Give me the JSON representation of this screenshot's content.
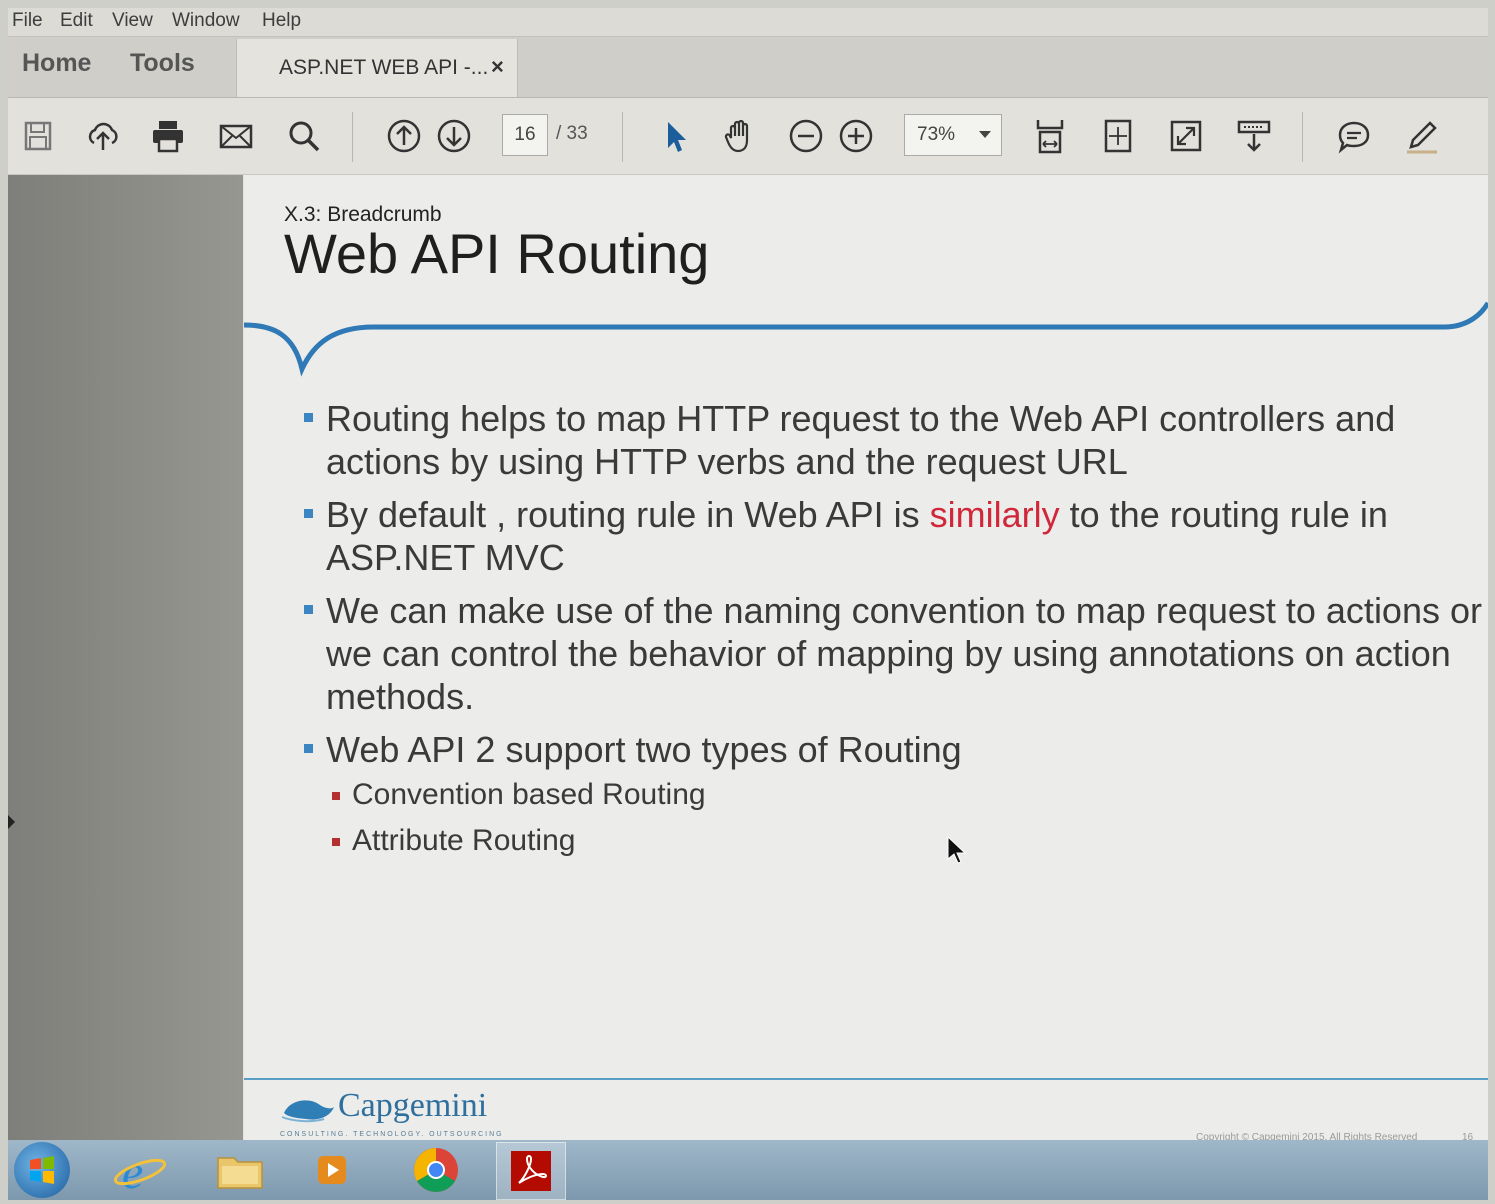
{
  "menu": [
    "File",
    "Edit",
    "View",
    "Window",
    "Help"
  ],
  "tabs": {
    "home": "Home",
    "tools": "Tools",
    "document": "ASP.NET WEB API -...",
    "close": "×"
  },
  "toolbar": {
    "current_page": "16",
    "total_pages": "/ 33",
    "zoom": "73%"
  },
  "slide": {
    "breadcrumb": "X.3: Breadcrumb",
    "title": "Web API Routing",
    "bullets": [
      {
        "text": "Routing helps to map HTTP request to the Web API controllers and actions by using HTTP verbs and the request URL"
      },
      {
        "before": "By default , routing rule in Web API is ",
        "highlight": "similarly",
        "after": " to the routing rule in ASP.NET MVC"
      },
      {
        "text": "We can make use of the naming convention to map request to actions or we can control the behavior of mapping by using annotations on action methods."
      },
      {
        "text": "Web API 2 support two types of Routing"
      }
    ],
    "sub_bullets": [
      "Convention based Routing",
      "Attribute Routing"
    ],
    "logo": "Capgemini",
    "logo_tagline": "CONSULTING. TECHNOLOGY. OUTSOURCING",
    "copyright": "Copyright © Capgemini 2015. All Rights Reserved",
    "page_number": "16"
  },
  "colors": {
    "accent_blue": "#3b86c2",
    "highlight_red": "#d0283a",
    "sub_bullet_red": "#b33030"
  }
}
